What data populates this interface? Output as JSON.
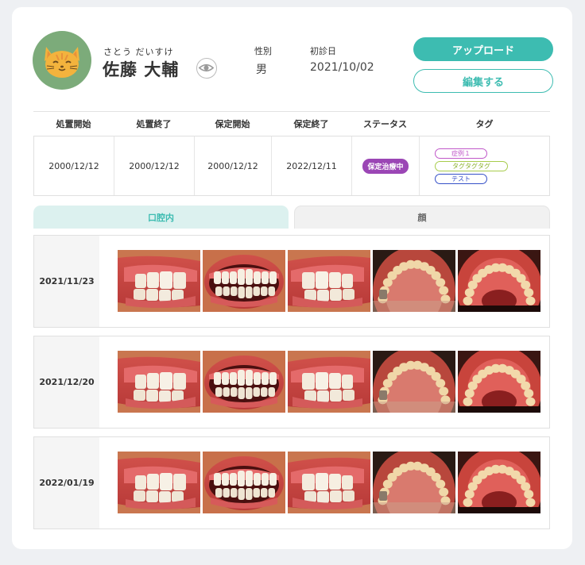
{
  "patient": {
    "kana": "さとう だいすけ",
    "name": "佐藤 大輔",
    "gender_label": "性別",
    "gender": "男",
    "first_visit_label": "初診日",
    "first_visit": "2021/10/02"
  },
  "buttons": {
    "upload": "アップロード",
    "edit": "編集する"
  },
  "info": {
    "headers": [
      "処置開始",
      "処置終了",
      "保定開始",
      "保定終了",
      "ステータス",
      "タグ"
    ],
    "values": [
      "2000/12/12",
      "2000/12/12",
      "2000/12/12",
      "2022/12/11"
    ],
    "status": "保定治療中",
    "tags": [
      "症例１",
      "タグタグタグ",
      "テスト"
    ]
  },
  "tabs": [
    {
      "label": "口腔内",
      "active": true
    },
    {
      "label": "顔",
      "active": false
    }
  ],
  "photo_rows": [
    {
      "date": "2021/11/23"
    },
    {
      "date": "2021/12/20"
    },
    {
      "date": "2022/01/19"
    }
  ],
  "photo_views": [
    "right-lateral",
    "frontal",
    "left-lateral",
    "upper-occlusal",
    "lower-occlusal"
  ],
  "colors": {
    "accent": "#3dbcb1",
    "status": "#9b46b5",
    "avatar_bg": "#7cab7a"
  }
}
